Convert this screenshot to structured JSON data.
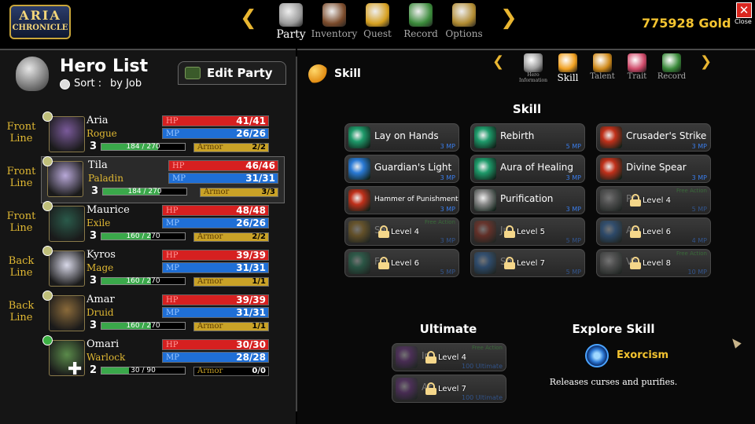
{
  "logo": {
    "line1": "ARIA",
    "line2": "CHRONICLE"
  },
  "nav": {
    "items": [
      {
        "label": "Party",
        "icon": "helmet-icon",
        "active": true
      },
      {
        "label": "Inventory",
        "icon": "chest-icon",
        "active": false
      },
      {
        "label": "Quest",
        "icon": "trophy-icon",
        "active": false
      },
      {
        "label": "Record",
        "icon": "scroll-icon",
        "active": false
      },
      {
        "label": "Options",
        "icon": "gear-icon",
        "active": false
      }
    ]
  },
  "gold": "775928 Gold",
  "close_label": "Close",
  "hero_list": {
    "title": "Hero List",
    "sort_label": "Sort :",
    "sort_value": "by Job",
    "edit_party": "Edit Party"
  },
  "heroes": [
    {
      "line": "Front Line",
      "name": "Aria",
      "cls": "Rogue",
      "level": "3",
      "xp": "184 / 270",
      "xp_frac": 0.68,
      "hp_label": "HP",
      "hp": "41/41",
      "hp_frac": 1.0,
      "mp_label": "MP",
      "mp": "26/26",
      "mp_frac": 1.0,
      "armor_label": "Armor",
      "armor": "2/2",
      "armor_frac": 1.0,
      "mood": "neutral",
      "color": "#7a5a9a"
    },
    {
      "line": "Front Line",
      "name": "Tila",
      "cls": "Paladin",
      "level": "3",
      "xp": "184 / 270",
      "xp_frac": 0.68,
      "hp_label": "HP",
      "hp": "46/46",
      "hp_frac": 1.0,
      "mp_label": "MP",
      "mp": "31/31",
      "mp_frac": 1.0,
      "armor_label": "Armor",
      "armor": "3/3",
      "armor_frac": 1.0,
      "mood": "neutral",
      "color": "#b8a8d8",
      "selected": true
    },
    {
      "line": "Front Line",
      "name": "Maurice",
      "cls": "Exile",
      "level": "3",
      "xp": "160 / 270",
      "xp_frac": 0.59,
      "hp_label": "HP",
      "hp": "48/48",
      "hp_frac": 1.0,
      "mp_label": "MP",
      "mp": "26/26",
      "mp_frac": 1.0,
      "armor_label": "Armor",
      "armor": "2/2",
      "armor_frac": 1.0,
      "mood": "neutral",
      "color": "#2a5a4a"
    },
    {
      "line": "Back Line",
      "name": "Kyros",
      "cls": "Mage",
      "level": "3",
      "xp": "160 / 270",
      "xp_frac": 0.59,
      "hp_label": "HP",
      "hp": "39/39",
      "hp_frac": 1.0,
      "mp_label": "MP",
      "mp": "31/31",
      "mp_frac": 1.0,
      "armor_label": "Armor",
      "armor": "1/1",
      "armor_frac": 1.0,
      "mood": "neutral",
      "color": "#d8d8e8"
    },
    {
      "line": "Back Line",
      "name": "Amar",
      "cls": "Druid",
      "level": "3",
      "xp": "160 / 270",
      "xp_frac": 0.59,
      "hp_label": "HP",
      "hp": "39/39",
      "hp_frac": 1.0,
      "mp_label": "MP",
      "mp": "31/31",
      "mp_frac": 1.0,
      "armor_label": "Armor",
      "armor": "1/1",
      "armor_frac": 1.0,
      "mood": "neutral",
      "color": "#8a6a3a"
    },
    {
      "line": "",
      "name": "Omari",
      "cls": "Warlock",
      "level": "2",
      "xp": "30 / 90",
      "xp_frac": 0.33,
      "hp_label": "HP",
      "hp": "30/30",
      "hp_frac": 1.0,
      "mp_label": "MP",
      "mp": "28/28",
      "mp_frac": 1.0,
      "armor_label": "Armor",
      "armor": "0/0",
      "armor_frac": 0.0,
      "mood": "happy",
      "color": "#5a8a4a",
      "bonus": true
    }
  ],
  "right": {
    "header": "Skill",
    "tabs": [
      {
        "label": "Hero Information",
        "icon": "helmet-icon",
        "active": false
      },
      {
        "label": "Skill",
        "icon": "skill-icon",
        "active": true
      },
      {
        "label": "Talent",
        "icon": "heart-icon",
        "active": false
      },
      {
        "label": "Trait",
        "icon": "trait-icon",
        "active": false
      },
      {
        "label": "Record",
        "icon": "hourglass-icon",
        "active": false
      }
    ],
    "skill_title": "Skill",
    "skills": [
      {
        "name": "Lay on Hands",
        "cost": "3 MP",
        "tag": "",
        "locked": false,
        "lvl": "",
        "icon": "hands-icon",
        "color": "#1e9a6a"
      },
      {
        "name": "Rebirth",
        "cost": "5 MP",
        "tag": "",
        "locked": false,
        "lvl": "",
        "icon": "cross-icon",
        "color": "#1e9a6a"
      },
      {
        "name": "Crusader's Strike",
        "cost": "3 MP",
        "tag": "",
        "locked": false,
        "lvl": "",
        "icon": "strike-icon",
        "color": "#c0301a"
      },
      {
        "name": "Guardian's Light",
        "cost": "3 MP",
        "tag": "",
        "locked": false,
        "lvl": "",
        "icon": "light-icon",
        "color": "#2a7ad6"
      },
      {
        "name": "Aura of Healing",
        "cost": "3 MP",
        "tag": "",
        "locked": false,
        "lvl": "",
        "icon": "aura-icon",
        "color": "#1e9a6a"
      },
      {
        "name": "Divine Spear",
        "cost": "3 MP",
        "tag": "",
        "locked": false,
        "lvl": "",
        "icon": "spear-icon",
        "color": "#c0301a"
      },
      {
        "name": "Hammer of Punishment",
        "cost": "3 MP",
        "tag": "",
        "locked": false,
        "lvl": "",
        "icon": "hammer-icon",
        "color": "#c0301a",
        "small": true
      },
      {
        "name": "Purification",
        "cost": "3 MP",
        "tag": "",
        "locked": false,
        "lvl": "",
        "icon": "purify-icon",
        "color": "#8a8a8a"
      },
      {
        "name": "Pr",
        "cost": "5 MP",
        "tag": "Free Action",
        "locked": true,
        "lvl": "Level 4",
        "icon": "prayer-icon",
        "color": "#8a8a8a"
      },
      {
        "name": "Sa",
        "cost": "3 MP",
        "tag": "Free Action",
        "locked": true,
        "lvl": "Level 4",
        "icon": "sacred-icon",
        "color": "#c08a1a"
      },
      {
        "name": "Ju",
        "cost": "5 MP",
        "tag": "",
        "locked": true,
        "lvl": "Level 5",
        "icon": "judgement-icon",
        "color": "#c0301a"
      },
      {
        "name": "Ar",
        "cost": "4 MP",
        "tag": "",
        "locked": true,
        "lvl": "Level 6",
        "icon": "shell-icon",
        "color": "#2a7ad6"
      },
      {
        "name": "Fo",
        "cost": "5 MP",
        "tag": "",
        "locked": true,
        "lvl": "Level 6",
        "icon": "fortress-icon",
        "color": "#1e9a6a"
      },
      {
        "name": "Sh",
        "cost": "5 MP",
        "tag": "",
        "locked": true,
        "lvl": "Level 7",
        "icon": "shield-icon",
        "color": "#2a7ad6"
      },
      {
        "name": "Va",
        "cost": "10 MP",
        "tag": "Free Action",
        "locked": true,
        "lvl": "Level 8",
        "icon": "valor-icon",
        "color": "#8a8a8a"
      }
    ],
    "ultimate_title": "Ultimate",
    "ultimates": [
      {
        "name": "In",
        "cost": "100 Ultimate",
        "tag": "Free Action",
        "locked": true,
        "lvl": "Level 4",
        "icon": "ultimate-1-icon",
        "color": "#7a2a9a"
      },
      {
        "name": "Ar",
        "cost": "100 Ultimate",
        "tag": "",
        "locked": true,
        "lvl": "Level 7",
        "icon": "ultimate-2-icon",
        "color": "#7a2a9a"
      }
    ],
    "explore_title": "Explore Skill",
    "explore_name": "Exorcism",
    "explore_desc": "Releases curses and purifies."
  }
}
